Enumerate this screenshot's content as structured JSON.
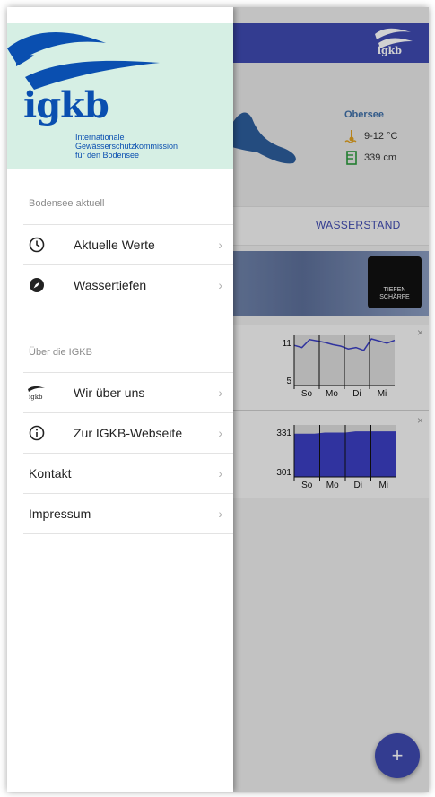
{
  "app": {
    "header_logo_text": "igkb",
    "lake": {
      "name": "Obersee",
      "temperature": "9-12 °C",
      "water_level": "339 cm"
    },
    "tab_label": "WASSERSTAND",
    "photo_badge": "TIEFEN SCHÄRFE",
    "fab_label": "+"
  },
  "drawer": {
    "brand": {
      "logo_text": "igkb",
      "subtitle_lines": [
        "Internationale",
        "Gewässerschutzkommission",
        "für den Bodensee"
      ]
    },
    "sections": [
      {
        "label": "Bodensee aktuell",
        "items": [
          {
            "label": "Aktuelle Werte",
            "icon": "clock-icon"
          },
          {
            "label": "Wassertiefen",
            "icon": "compass-icon"
          }
        ]
      },
      {
        "label": "Über die IGKB",
        "items": [
          {
            "label": "Wir über uns",
            "icon": "igkb-logo-icon"
          },
          {
            "label": "Zur IGKB-Webseite",
            "icon": "info-icon"
          }
        ]
      }
    ],
    "plain_items": [
      {
        "label": "Kontakt"
      },
      {
        "label": "Impressum"
      }
    ],
    "chevron": "›"
  },
  "chart_data": [
    {
      "type": "line",
      "categories": [
        "So",
        "Mo",
        "Di",
        "Mi"
      ],
      "y_ticks": [
        "11",
        "5"
      ],
      "ylim": [
        5,
        12
      ],
      "values": [
        10.6,
        10.3,
        11.4,
        11.2,
        11.0,
        10.7,
        10.5,
        10.1,
        10.3,
        9.9,
        11.5,
        11.2,
        10.9,
        11.3
      ]
    },
    {
      "type": "area",
      "categories": [
        "So",
        "Mo",
        "Di",
        "Mi"
      ],
      "y_ticks": [
        "331",
        "301"
      ],
      "ylim": [
        301,
        345
      ],
      "values": [
        337,
        337,
        337,
        338,
        338,
        338,
        339,
        339,
        339,
        339,
        339
      ]
    }
  ]
}
